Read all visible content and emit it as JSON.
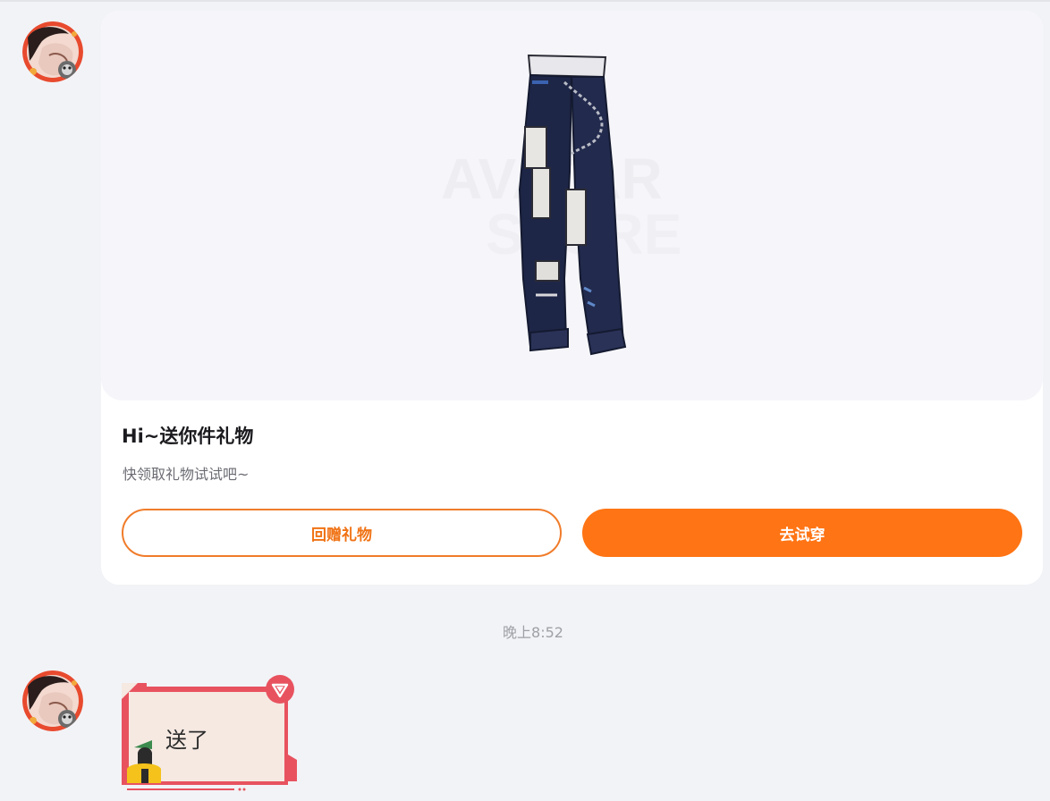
{
  "chat": {
    "gift_message": {
      "item_icon": "jeans-icon",
      "title": "Hi~送你件礼物",
      "subtitle": "快领取礼物试试吧~",
      "return_gift_label": "回赠礼物",
      "try_on_label": "去试穿"
    },
    "timestamp": "晚上8:52",
    "reply_message": {
      "text": "送了",
      "badge_icon": "heart-badge-icon"
    }
  },
  "colors": {
    "accent": "#ff7414",
    "page_background": "#f2f3f7",
    "sticker_border": "#e8525f"
  }
}
